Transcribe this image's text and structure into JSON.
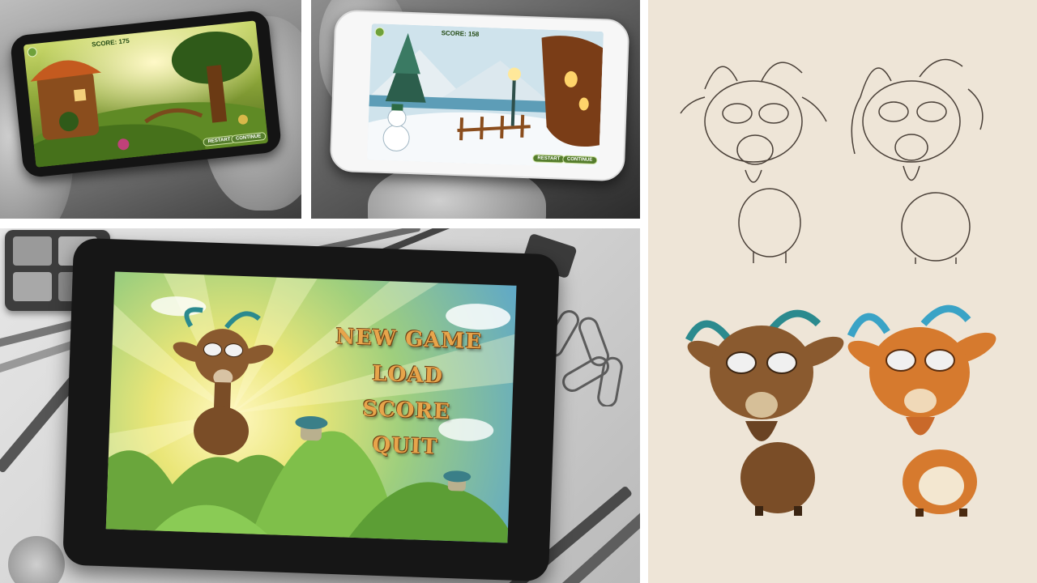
{
  "game": {
    "menu": {
      "items": [
        "NEW GAME",
        "LOAD",
        "SCORE",
        "QUIT"
      ]
    },
    "hud": {
      "score_label_forest": "SCORE: 175",
      "score_label_winter": "SCORE: 158",
      "restart_label": "RESTART",
      "next_label": "CONTINUE"
    }
  },
  "colors": {
    "menu_text": "#e7a54b",
    "menu_outline": "#6e3d12",
    "goat_brown": "#8a5a2f",
    "goat_orange": "#d67a2e",
    "horn_teal": "#2b8a8e",
    "horn_blue": "#3aa3c6",
    "paper": "#eee5d7"
  },
  "icons": [
    "paperclip-icon",
    "binder-clip-icon",
    "pencil-icon",
    "marker-icon",
    "palette-icon"
  ]
}
